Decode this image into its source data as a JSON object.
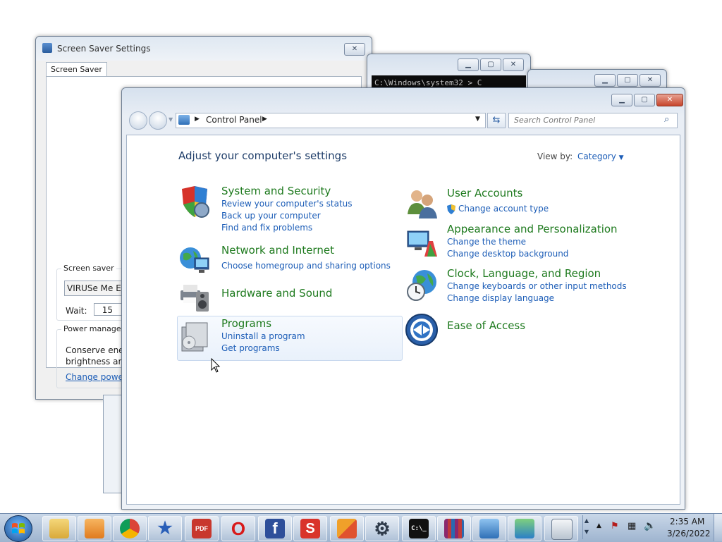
{
  "screensaver": {
    "title": "Screen Saver Settings",
    "tab": "Screen Saver",
    "group_screen_saver": "Screen saver",
    "selected_saver": "VIRUSe Me Elm",
    "wait_label": "Wait:",
    "wait_value": "15",
    "group_power": "Power manager",
    "power_text_1": "Conserve energ",
    "power_text_2": "brightness and",
    "power_link": "Change power"
  },
  "console": {
    "text": "C:\\Windows\\system32 > C"
  },
  "control_panel": {
    "address_item": "Control Panel",
    "search_placeholder": "Search Control Panel",
    "heading": "Adjust your computer's settings",
    "view_by_label": "View by:",
    "view_by_value": "Category",
    "categories": [
      {
        "title": "System and Security",
        "links": [
          "Review your computer's status",
          "Back up your computer",
          "Find and fix problems"
        ]
      },
      {
        "title": "Network and Internet",
        "links": [
          "Choose homegroup and sharing options"
        ]
      },
      {
        "title": "Hardware and Sound",
        "links": []
      },
      {
        "title": "Programs",
        "links": [
          "Uninstall a program",
          "Get programs"
        ]
      },
      {
        "title": "User Accounts",
        "links": [
          "Change account type"
        ]
      },
      {
        "title": "Appearance and Personalization",
        "links": [
          "Change the theme",
          "Change desktop background"
        ]
      },
      {
        "title": "Clock, Language, and Region",
        "links": [
          "Change keyboards or other input methods",
          "Change display language"
        ]
      },
      {
        "title": "Ease of Access",
        "links": []
      }
    ]
  },
  "taskbar": {
    "items": [
      {
        "icon": "explorer-icon",
        "label": ""
      },
      {
        "icon": "media-player-icon",
        "label": ""
      },
      {
        "icon": "chrome-icon",
        "label": ""
      },
      {
        "icon": "star-icon",
        "label": ""
      },
      {
        "icon": "pdf-icon",
        "label": "PDF"
      },
      {
        "icon": "opera-icon",
        "label": "O"
      },
      {
        "icon": "facebook-icon",
        "label": "f"
      },
      {
        "icon": "s-app-icon",
        "label": "S"
      },
      {
        "icon": "office-icon",
        "label": ""
      },
      {
        "icon": "gear-app-icon",
        "label": ""
      },
      {
        "icon": "cmd-icon",
        "label": "C:\\_"
      },
      {
        "icon": "winrar-icon",
        "label": ""
      },
      {
        "icon": "control-panel-icon",
        "label": ""
      },
      {
        "icon": "display-icon",
        "label": ""
      },
      {
        "icon": "window-icon",
        "label": ""
      }
    ],
    "clock_time": "2:35 AM",
    "clock_date": "3/26/2022"
  },
  "colors": {
    "link": "#1c5db7",
    "category_title": "#1e7a1e",
    "heading": "#1e3d69"
  }
}
